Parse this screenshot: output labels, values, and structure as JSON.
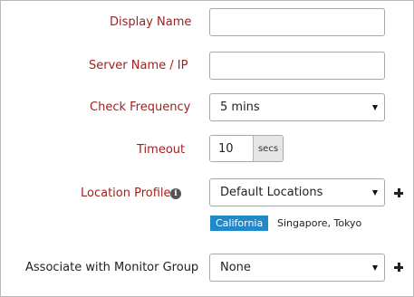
{
  "form": {
    "display_name": {
      "label": "Display Name",
      "value": ""
    },
    "server_name": {
      "label": "Server Name / IP",
      "value": ""
    },
    "check_frequency": {
      "label": "Check Frequency",
      "selected": "5 mins"
    },
    "timeout": {
      "label": "Timeout",
      "value": "10",
      "unit": "secs"
    },
    "location_profile": {
      "label": "Location Profile",
      "selected": "Default Locations",
      "primary_location": "California",
      "other_locations": "Singapore, Tokyo"
    },
    "monitor_group": {
      "label": "Associate with Monitor Group",
      "selected": "None"
    }
  },
  "colors": {
    "required_label": "#a32020",
    "tag_background": "#2189c9",
    "unit_background": "#e5e5e5"
  },
  "icons": {
    "info": "info-icon",
    "add": "plus-icon",
    "dropdown": "caret-down-icon"
  }
}
